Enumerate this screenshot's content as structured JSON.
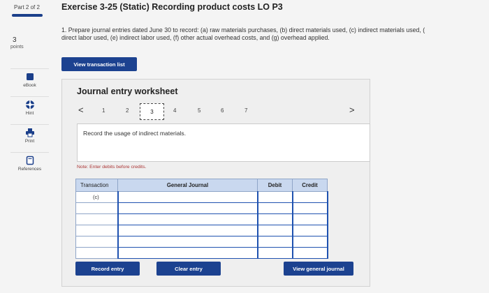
{
  "rail": {
    "part_label": "Part 2 of 2",
    "question_number": "3",
    "points_label": "points",
    "tools": [
      {
        "label": "eBook",
        "icon": "book-icon"
      },
      {
        "label": "Hint",
        "icon": "lifebuoy-icon"
      },
      {
        "label": "Print",
        "icon": "printer-icon"
      },
      {
        "label": "References",
        "icon": "document-icon"
      }
    ]
  },
  "header": {
    "title": "Exercise 3-25 (Static) Recording product costs LO P3",
    "question_line1": "1. Prepare journal entries dated June 30 to record: (a) raw materials purchases, (b) direct materials used, (c) indirect materials used, (",
    "question_line2": "direct labor used, (e) indirect labor used, (f) other actual overhead costs, and (g) overhead applied.",
    "view_transaction_button": "View transaction list"
  },
  "worksheet": {
    "title": "Journal entry worksheet",
    "prev_arrow": "<",
    "next_arrow": ">",
    "pages": [
      "1",
      "2",
      "3",
      "4",
      "5",
      "6",
      "7"
    ],
    "current_page": "3",
    "instruction": "Record the usage of indirect materials.",
    "note": "Note: Enter debits before credits."
  },
  "table": {
    "headers": {
      "transaction": "Transaction",
      "general_journal": "General Journal",
      "debit": "Debit",
      "credit": "Credit"
    },
    "rows": [
      {
        "transaction": "(c)"
      },
      {
        "transaction": ""
      },
      {
        "transaction": ""
      },
      {
        "transaction": ""
      },
      {
        "transaction": ""
      },
      {
        "transaction": ""
      }
    ]
  },
  "footer": {
    "record_entry": "Record entry",
    "clear_entry": "Clear entry",
    "view_general_journal": "View general journal"
  },
  "colors": {
    "accent": "#1c4290",
    "table_header": "#c9d8ef",
    "input_border": "#1f52b0"
  }
}
